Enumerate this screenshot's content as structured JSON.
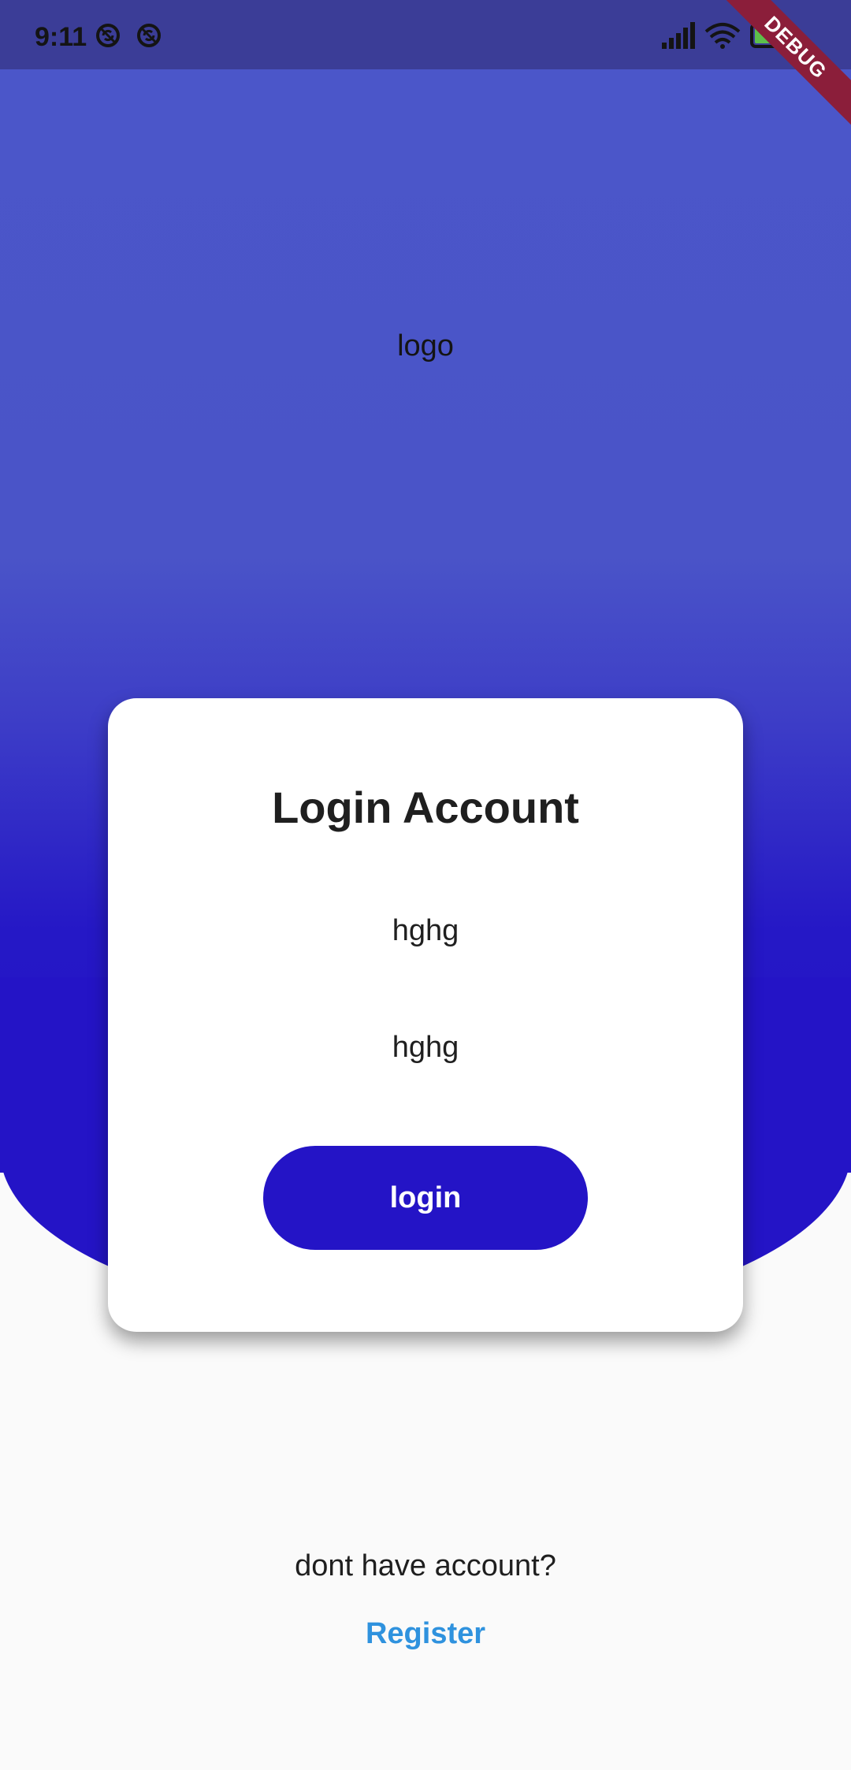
{
  "status_bar": {
    "time": "9:11",
    "battery_level": "73",
    "debug_label": "DEBUG",
    "icons": [
      "sync-off-icon",
      "sync-off-icon",
      "signal-icon",
      "wifi-icon",
      "battery-icon"
    ]
  },
  "hero": {
    "logo_text": "logo",
    "colors": {
      "top": "#4B56C9",
      "bottom": "#2414C6"
    }
  },
  "card": {
    "title": "Login Account",
    "field_1_value": "hghg",
    "field_2_value": "hghg",
    "login_label": "login"
  },
  "footer": {
    "prompt": "dont have account?",
    "register_label": "Register",
    "link_color": "#2F92DE"
  }
}
